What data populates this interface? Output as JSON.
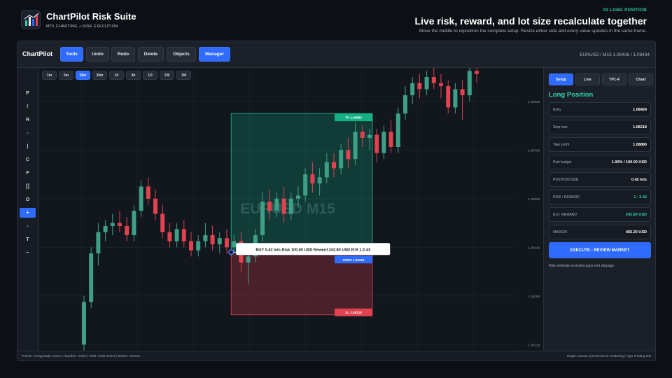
{
  "brand": {
    "title": "ChartPilot Risk Suite",
    "subtitle": "MT5 CHARTING + RISK EXECUTION",
    "logo_icon": "chart-logo-icon"
  },
  "hero": {
    "kicker": "02  LONG POSITION",
    "title": "Live risk, reward, and lot size recalculate together",
    "subtitle": "Move the middle to reposition the complete setup. Resize either side and every value updates in the same frame."
  },
  "toolbar": {
    "app_name": "ChartPilot",
    "buttons": [
      {
        "label": "Tools",
        "active": true
      },
      {
        "label": "Undo",
        "active": false
      },
      {
        "label": "Redo",
        "active": false
      },
      {
        "label": "Delete",
        "active": false
      },
      {
        "label": "Objects",
        "active": false
      },
      {
        "label": "Manager",
        "active": true
      }
    ],
    "symbol_info": "EURUSD / M15     1.08426 / 1.08434"
  },
  "tools": [
    "P",
    "/",
    "R",
    "-",
    "|",
    "C",
    "F",
    "[]",
    "O",
    "+",
    "-",
    "T",
    "~"
  ],
  "tools_active_index": 9,
  "timeframes": {
    "items": [
      "1m",
      "5m",
      "15m",
      "30m",
      "1h",
      "4h",
      "1D",
      "1W",
      "1M"
    ],
    "active_index": 2
  },
  "chart": {
    "watermark": "EURUSD  M15",
    "price_labels": [
      "1.08920",
      "1.08760",
      "1.08600",
      "1.08440",
      "1.08280",
      "1.08120"
    ],
    "position_info": "BUY 0.42 lots   Risk 100.00 USD   Reward 242.80 USD   R:R 1:2.43",
    "tp_label": "TP 1.08880",
    "open_label": "OPEN 1.08424",
    "sl_label": "SL 1.08218",
    "colors": {
      "up": "#3f9f86",
      "down": "#e0434f",
      "tp_zone": "#0f9f7f",
      "sl_zone": "#c23946",
      "accent": "#2f6bff"
    }
  },
  "chart_data": {
    "type": "candlestick",
    "symbol": "EURUSD",
    "timeframe": "M15",
    "ylim": [
      1.081,
      1.0903
    ],
    "y_ticks": [
      1.0892,
      1.0876,
      1.086,
      1.0844,
      1.0828,
      1.0812
    ],
    "candles": [
      {
        "o": 1.0812,
        "h": 1.0828,
        "l": 1.0806,
        "c": 1.0826
      },
      {
        "o": 1.0826,
        "h": 1.0844,
        "l": 1.0824,
        "c": 1.0842
      },
      {
        "o": 1.0842,
        "h": 1.0852,
        "l": 1.0838,
        "c": 1.0849
      },
      {
        "o": 1.0849,
        "h": 1.0853,
        "l": 1.0846,
        "c": 1.0851
      },
      {
        "o": 1.0851,
        "h": 1.0855,
        "l": 1.0848,
        "c": 1.0852
      },
      {
        "o": 1.0852,
        "h": 1.0856,
        "l": 1.0849,
        "c": 1.0851
      },
      {
        "o": 1.0851,
        "h": 1.0854,
        "l": 1.0846,
        "c": 1.0848
      },
      {
        "o": 1.0848,
        "h": 1.0858,
        "l": 1.0846,
        "c": 1.0856
      },
      {
        "o": 1.0856,
        "h": 1.0866,
        "l": 1.0854,
        "c": 1.0864
      },
      {
        "o": 1.0864,
        "h": 1.0867,
        "l": 1.0858,
        "c": 1.086
      },
      {
        "o": 1.086,
        "h": 1.0863,
        "l": 1.0853,
        "c": 1.0855
      },
      {
        "o": 1.0855,
        "h": 1.0858,
        "l": 1.0847,
        "c": 1.0849
      },
      {
        "o": 1.0849,
        "h": 1.0852,
        "l": 1.0844,
        "c": 1.0846
      },
      {
        "o": 1.0846,
        "h": 1.0852,
        "l": 1.0844,
        "c": 1.085
      },
      {
        "o": 1.085,
        "h": 1.0853,
        "l": 1.0844,
        "c": 1.0846
      },
      {
        "o": 1.0846,
        "h": 1.0849,
        "l": 1.0841,
        "c": 1.0843
      },
      {
        "o": 1.0843,
        "h": 1.0848,
        "l": 1.0841,
        "c": 1.0846
      },
      {
        "o": 1.0846,
        "h": 1.0852,
        "l": 1.0844,
        "c": 1.0848
      },
      {
        "o": 1.0848,
        "h": 1.0851,
        "l": 1.0843,
        "c": 1.0845
      },
      {
        "o": 1.0845,
        "h": 1.0849,
        "l": 1.0842,
        "c": 1.0847
      },
      {
        "o": 1.0847,
        "h": 1.085,
        "l": 1.0842,
        "c": 1.0844
      },
      {
        "o": 1.0844,
        "h": 1.0848,
        "l": 1.0842,
        "c": 1.0846
      },
      {
        "o": 1.0846,
        "h": 1.0849,
        "l": 1.0836,
        "c": 1.0839
      },
      {
        "o": 1.0839,
        "h": 1.0843,
        "l": 1.0832,
        "c": 1.0841
      },
      {
        "o": 1.0841,
        "h": 1.085,
        "l": 1.0839,
        "c": 1.0848
      },
      {
        "o": 1.0848,
        "h": 1.0862,
        "l": 1.0846,
        "c": 1.0859
      },
      {
        "o": 1.0859,
        "h": 1.0863,
        "l": 1.0853,
        "c": 1.0856
      },
      {
        "o": 1.0856,
        "h": 1.0862,
        "l": 1.0854,
        "c": 1.086
      },
      {
        "o": 1.086,
        "h": 1.0864,
        "l": 1.0852,
        "c": 1.0855
      },
      {
        "o": 1.0855,
        "h": 1.0862,
        "l": 1.0853,
        "c": 1.086
      },
      {
        "o": 1.086,
        "h": 1.0864,
        "l": 1.0857,
        "c": 1.0861
      },
      {
        "o": 1.0861,
        "h": 1.087,
        "l": 1.0859,
        "c": 1.0868
      },
      {
        "o": 1.0868,
        "h": 1.0872,
        "l": 1.0862,
        "c": 1.0865
      },
      {
        "o": 1.0865,
        "h": 1.087,
        "l": 1.0861,
        "c": 1.0867
      },
      {
        "o": 1.0867,
        "h": 1.0875,
        "l": 1.0865,
        "c": 1.0872
      },
      {
        "o": 1.0872,
        "h": 1.0875,
        "l": 1.0867,
        "c": 1.087
      },
      {
        "o": 1.087,
        "h": 1.0878,
        "l": 1.0868,
        "c": 1.0876
      },
      {
        "o": 1.0876,
        "h": 1.088,
        "l": 1.087,
        "c": 1.0873
      },
      {
        "o": 1.0873,
        "h": 1.0885,
        "l": 1.0871,
        "c": 1.0882
      },
      {
        "o": 1.0882,
        "h": 1.0884,
        "l": 1.0877,
        "c": 1.088
      },
      {
        "o": 1.088,
        "h": 1.0883,
        "l": 1.0876,
        "c": 1.0881
      },
      {
        "o": 1.0881,
        "h": 1.0883,
        "l": 1.0872,
        "c": 1.0875
      },
      {
        "o": 1.0875,
        "h": 1.0884,
        "l": 1.0873,
        "c": 1.0882
      },
      {
        "o": 1.0882,
        "h": 1.0886,
        "l": 1.0875,
        "c": 1.0877
      },
      {
        "o": 1.0877,
        "h": 1.089,
        "l": 1.0875,
        "c": 1.0888
      },
      {
        "o": 1.0888,
        "h": 1.0897,
        "l": 1.0886,
        "c": 1.0894
      },
      {
        "o": 1.0894,
        "h": 1.09,
        "l": 1.0891,
        "c": 1.0898
      },
      {
        "o": 1.0898,
        "h": 1.0901,
        "l": 1.0893,
        "c": 1.0896
      },
      {
        "o": 1.0896,
        "h": 1.0902,
        "l": 1.0894,
        "c": 1.09
      },
      {
        "o": 1.09,
        "h": 1.0903,
        "l": 1.0896,
        "c": 1.0898
      },
      {
        "o": 1.0898,
        "h": 1.0901,
        "l": 1.0893,
        "c": 1.0897
      },
      {
        "o": 1.0897,
        "h": 1.0899,
        "l": 1.0888,
        "c": 1.089
      },
      {
        "o": 1.089,
        "h": 1.0898,
        "l": 1.0888,
        "c": 1.0896
      },
      {
        "o": 1.0896,
        "h": 1.0899,
        "l": 1.0886,
        "c": 1.0894
      },
      {
        "o": 1.0894,
        "h": 1.0903,
        "l": 1.0892,
        "c": 1.0902
      },
      {
        "o": 1.0902,
        "h": 1.0904,
        "l": 1.0898,
        "c": 1.0901
      }
    ],
    "position": {
      "side": "long",
      "tp": 1.0888,
      "open": 1.08424,
      "sl": 1.08218,
      "start_index": 21,
      "end_index": 40
    }
  },
  "panel": {
    "tabs": [
      {
        "label": "Setup",
        "active": true
      },
      {
        "label": "Live",
        "active": false
      },
      {
        "label": "TP1-4",
        "active": false
      },
      {
        "label": "Chart",
        "active": false
      }
    ],
    "title": "Long Position",
    "fields": [
      {
        "label": "Entry",
        "value": "1.08424",
        "color": "default"
      },
      {
        "label": "Stop loss",
        "value": "1.08218",
        "color": "default"
      },
      {
        "label": "Take profit",
        "value": "1.08880",
        "color": "default"
      },
      {
        "label": "Risk budget",
        "value": "1.00% / 100.00 USD",
        "color": "default"
      },
      {
        "label": "POSITION SIZE",
        "value": "0.42 lots",
        "color": "default"
      },
      {
        "label": "RISK / REWARD",
        "value": "1 : 2.43",
        "color": "green"
      },
      {
        "label": "EST. REWARD",
        "value": "242.80 USD",
        "color": "green"
      },
      {
        "label": "MARGIN",
        "value": "455.20 USD",
        "color": "default"
      }
    ],
    "execute_label": "EXECUTE - REVIEW MARKET",
    "note": "Risk estimate excludes gaps and slippage."
  },
  "status": {
    "left": "Pointer  |  Drag body: move  |  Handles: resize  |  Shift: multi-select  |  Delete: remove",
    "right": "Single-canvas synchronized rendering  |  Algo Trading ON"
  }
}
